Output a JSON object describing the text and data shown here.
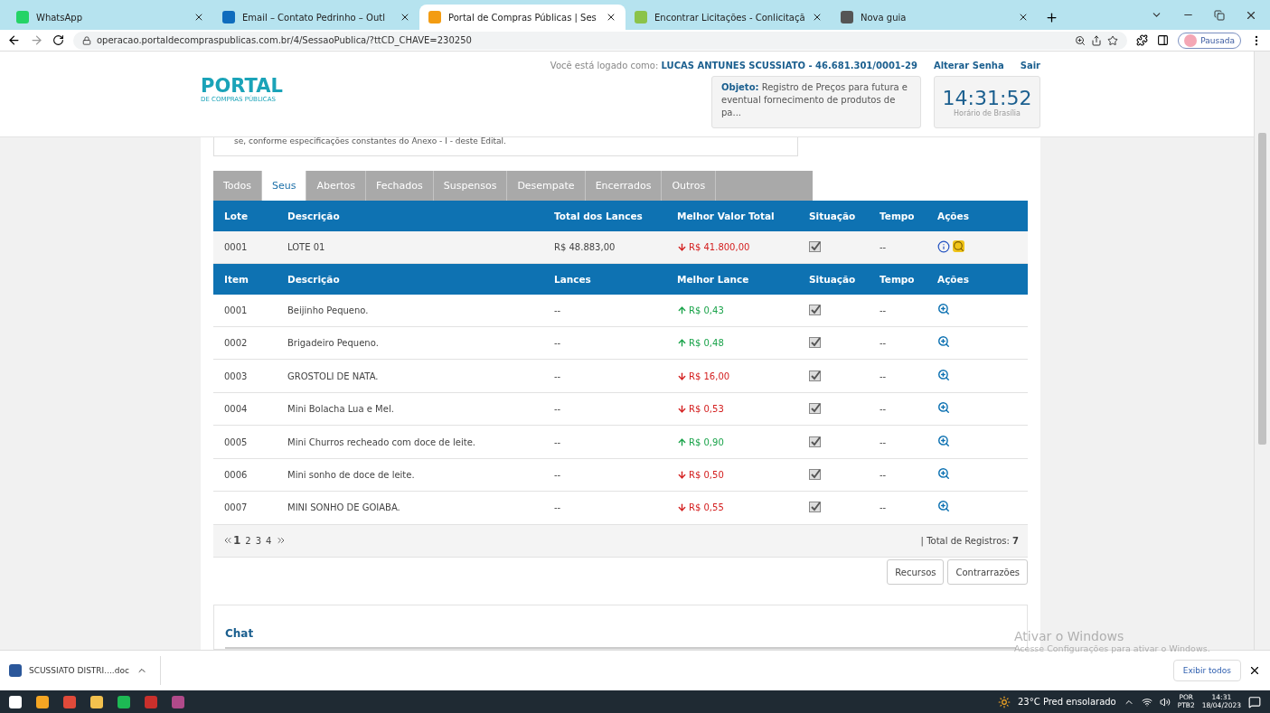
{
  "browser": {
    "tabs": [
      {
        "title": "WhatsApp",
        "selected": false
      },
      {
        "title": "Email – Contato Pedrinho – Outl",
        "selected": false
      },
      {
        "title": "Portal de Compras Públicas | Ses",
        "selected": true
      },
      {
        "title": "Encontrar Licitações - Conlicitaçã",
        "selected": false
      },
      {
        "title": "Nova guia",
        "selected": false
      }
    ],
    "url": "operacao.portaldecompraspublicas.com.br/4/SessaoPublica/?ttCD_CHAVE=230250",
    "profile": "Pausada"
  },
  "header": {
    "logo_main": "PORTAL",
    "logo_sub": "DE COMPRAS PÚBLICAS",
    "logged_label": "Você está logado como:",
    "user": "LUCAS ANTUNES SCUSSIATO - 46.681.301/0001-29",
    "links": [
      "Alterar Senha",
      "Sair"
    ],
    "objeto_label": "Objeto:",
    "objeto_text": "Registro de Preços para futura e eventual fornecimento de produtos de pa...",
    "clock": "14:31:52",
    "clock_caption": "Horário de Brasília"
  },
  "notice": "se, conforme especificações constantes do Anexo - I - deste Edital.",
  "tabs": [
    {
      "label": "Todos",
      "selected": false
    },
    {
      "label": "Seus",
      "selected": true
    },
    {
      "label": "Abertos",
      "selected": false
    },
    {
      "label": "Fechados",
      "selected": false
    },
    {
      "label": "Suspensos",
      "selected": false
    },
    {
      "label": "Desempate",
      "selected": false
    },
    {
      "label": "Encerrados",
      "selected": false
    },
    {
      "label": "Outros",
      "selected": false
    }
  ],
  "lote_table": {
    "columns": [
      "Lote",
      "Descrição",
      "Total dos Lances",
      "Melhor Valor Total",
      "Situação",
      "Tempo",
      "Ações"
    ],
    "rows": [
      {
        "lote": "0001",
        "descricao": "LOTE 01",
        "total": "R$ 48.883,00",
        "melhor": "R$ 41.800,00",
        "kind": "down",
        "tempo": "--"
      }
    ]
  },
  "item_table": {
    "columns": [
      "Item",
      "Descrição",
      "Lances",
      "Melhor Lance",
      "Situação",
      "Tempo",
      "Ações"
    ],
    "rows": [
      {
        "item": "0001",
        "descricao": "Beijinho Pequeno.",
        "lances": "--",
        "melhor": "R$ 0,43",
        "kind": "up",
        "tempo": "--"
      },
      {
        "item": "0002",
        "descricao": "Brigadeiro Pequeno.",
        "lances": "--",
        "melhor": "R$ 0,48",
        "kind": "up",
        "tempo": "--"
      },
      {
        "item": "0003",
        "descricao": "GROSTOLI DE NATA.",
        "lances": "--",
        "melhor": "R$ 16,00",
        "kind": "down",
        "tempo": "--"
      },
      {
        "item": "0004",
        "descricao": "Mini Bolacha Lua e Mel.",
        "lances": "--",
        "melhor": "R$ 0,53",
        "kind": "down",
        "tempo": "--"
      },
      {
        "item": "0005",
        "descricao": "Mini Churros recheado com doce de leite.",
        "lances": "--",
        "melhor": "R$ 0,90",
        "kind": "up",
        "tempo": "--"
      },
      {
        "item": "0006",
        "descricao": "Mini sonho de doce de leite.",
        "lances": "--",
        "melhor": "R$ 0,50",
        "kind": "down",
        "tempo": "--"
      },
      {
        "item": "0007",
        "descricao": "MINI SONHO DE GOIABA.",
        "lances": "--",
        "melhor": "R$ 0,55",
        "kind": "down",
        "tempo": "--"
      }
    ]
  },
  "pagination": {
    "pages": [
      {
        "label": "1",
        "selected": true
      },
      {
        "label": "2",
        "selected": false
      },
      {
        "label": "3",
        "selected": false
      },
      {
        "label": "4",
        "selected": false
      }
    ],
    "total_label": "| Total de Registros:",
    "total": "7"
  },
  "buttons": [
    "Recursos",
    "Contrarrazões"
  ],
  "chat_title": "Chat",
  "watermark": {
    "title": "Ativar o Windows",
    "text": "Acesse Configurações para ativar o Windows."
  },
  "downloads": {
    "file": "SCUSSIATO DISTRI....doc",
    "show_all": "Exibir todos"
  },
  "taskbar": {
    "temperature": "23°C",
    "weather": "Pred ensolarado",
    "lang": "POR",
    "layout": "PTB2",
    "time": "14:31",
    "date": "18/04/2023"
  }
}
